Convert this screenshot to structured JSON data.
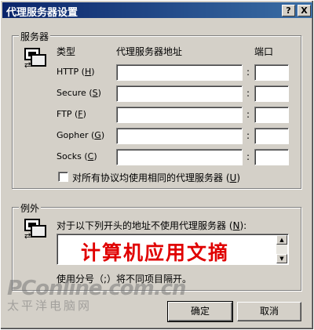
{
  "window": {
    "title": "代理服务器设置",
    "help_label": "?",
    "close_label": "X"
  },
  "servers": {
    "group_title": "服务器",
    "icon": "network-computers-icon",
    "col_type": "类型",
    "col_address": "代理服务器地址",
    "col_port": "端口",
    "rows": [
      {
        "label": "HTTP",
        "key": "H",
        "address": "",
        "port": ""
      },
      {
        "label": "Secure",
        "key": "S",
        "address": "",
        "port": ""
      },
      {
        "label": "FTP",
        "key": "F",
        "address": "",
        "port": ""
      },
      {
        "label": "Gopher",
        "key": "G",
        "address": "",
        "port": ""
      },
      {
        "label": "Socks",
        "key": "C",
        "address": "",
        "port": ""
      }
    ],
    "colon": ":",
    "same_proxy_label": "对所有协议均使用相同的代理服务器",
    "same_proxy_key": "U",
    "same_proxy_checked": false
  },
  "exceptions": {
    "group_title": "例外",
    "icon": "network-computers-icon",
    "label": "对于以下列开头的地址不使用代理服务器",
    "key": "N",
    "value": "计算机应用文摘",
    "hint": "使用分号（;）将不同项目隔开。"
  },
  "buttons": {
    "ok": "确定",
    "cancel": "取消"
  },
  "watermark": {
    "line1": "PConline.com.cn",
    "line2": "太平洋电脑网"
  }
}
